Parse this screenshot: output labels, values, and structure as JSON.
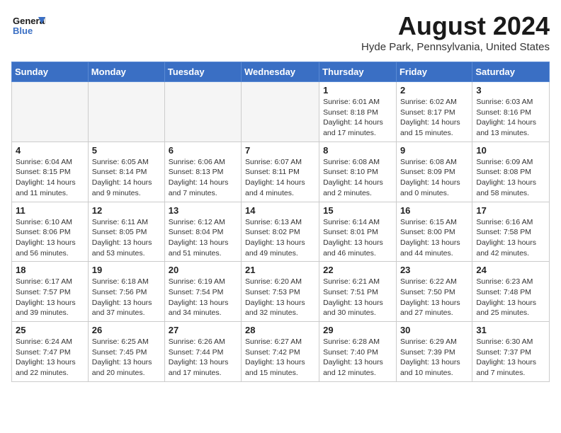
{
  "header": {
    "logo_text_general": "General",
    "logo_text_blue": "Blue",
    "month_year": "August 2024",
    "location": "Hyde Park, Pennsylvania, United States"
  },
  "weekdays": [
    "Sunday",
    "Monday",
    "Tuesday",
    "Wednesday",
    "Thursday",
    "Friday",
    "Saturday"
  ],
  "weeks": [
    [
      {
        "day": "",
        "empty": true
      },
      {
        "day": "",
        "empty": true
      },
      {
        "day": "",
        "empty": true
      },
      {
        "day": "",
        "empty": true
      },
      {
        "day": "1",
        "sunrise": "6:01 AM",
        "sunset": "8:18 PM",
        "daylight": "14 hours and 17 minutes."
      },
      {
        "day": "2",
        "sunrise": "6:02 AM",
        "sunset": "8:17 PM",
        "daylight": "14 hours and 15 minutes."
      },
      {
        "day": "3",
        "sunrise": "6:03 AM",
        "sunset": "8:16 PM",
        "daylight": "14 hours and 13 minutes."
      }
    ],
    [
      {
        "day": "4",
        "sunrise": "6:04 AM",
        "sunset": "8:15 PM",
        "daylight": "14 hours and 11 minutes."
      },
      {
        "day": "5",
        "sunrise": "6:05 AM",
        "sunset": "8:14 PM",
        "daylight": "14 hours and 9 minutes."
      },
      {
        "day": "6",
        "sunrise": "6:06 AM",
        "sunset": "8:13 PM",
        "daylight": "14 hours and 7 minutes."
      },
      {
        "day": "7",
        "sunrise": "6:07 AM",
        "sunset": "8:11 PM",
        "daylight": "14 hours and 4 minutes."
      },
      {
        "day": "8",
        "sunrise": "6:08 AM",
        "sunset": "8:10 PM",
        "daylight": "14 hours and 2 minutes."
      },
      {
        "day": "9",
        "sunrise": "6:08 AM",
        "sunset": "8:09 PM",
        "daylight": "14 hours and 0 minutes."
      },
      {
        "day": "10",
        "sunrise": "6:09 AM",
        "sunset": "8:08 PM",
        "daylight": "13 hours and 58 minutes."
      }
    ],
    [
      {
        "day": "11",
        "sunrise": "6:10 AM",
        "sunset": "8:06 PM",
        "daylight": "13 hours and 56 minutes."
      },
      {
        "day": "12",
        "sunrise": "6:11 AM",
        "sunset": "8:05 PM",
        "daylight": "13 hours and 53 minutes."
      },
      {
        "day": "13",
        "sunrise": "6:12 AM",
        "sunset": "8:04 PM",
        "daylight": "13 hours and 51 minutes."
      },
      {
        "day": "14",
        "sunrise": "6:13 AM",
        "sunset": "8:02 PM",
        "daylight": "13 hours and 49 minutes."
      },
      {
        "day": "15",
        "sunrise": "6:14 AM",
        "sunset": "8:01 PM",
        "daylight": "13 hours and 46 minutes."
      },
      {
        "day": "16",
        "sunrise": "6:15 AM",
        "sunset": "8:00 PM",
        "daylight": "13 hours and 44 minutes."
      },
      {
        "day": "17",
        "sunrise": "6:16 AM",
        "sunset": "7:58 PM",
        "daylight": "13 hours and 42 minutes."
      }
    ],
    [
      {
        "day": "18",
        "sunrise": "6:17 AM",
        "sunset": "7:57 PM",
        "daylight": "13 hours and 39 minutes."
      },
      {
        "day": "19",
        "sunrise": "6:18 AM",
        "sunset": "7:56 PM",
        "daylight": "13 hours and 37 minutes."
      },
      {
        "day": "20",
        "sunrise": "6:19 AM",
        "sunset": "7:54 PM",
        "daylight": "13 hours and 34 minutes."
      },
      {
        "day": "21",
        "sunrise": "6:20 AM",
        "sunset": "7:53 PM",
        "daylight": "13 hours and 32 minutes."
      },
      {
        "day": "22",
        "sunrise": "6:21 AM",
        "sunset": "7:51 PM",
        "daylight": "13 hours and 30 minutes."
      },
      {
        "day": "23",
        "sunrise": "6:22 AM",
        "sunset": "7:50 PM",
        "daylight": "13 hours and 27 minutes."
      },
      {
        "day": "24",
        "sunrise": "6:23 AM",
        "sunset": "7:48 PM",
        "daylight": "13 hours and 25 minutes."
      }
    ],
    [
      {
        "day": "25",
        "sunrise": "6:24 AM",
        "sunset": "7:47 PM",
        "daylight": "13 hours and 22 minutes."
      },
      {
        "day": "26",
        "sunrise": "6:25 AM",
        "sunset": "7:45 PM",
        "daylight": "13 hours and 20 minutes."
      },
      {
        "day": "27",
        "sunrise": "6:26 AM",
        "sunset": "7:44 PM",
        "daylight": "13 hours and 17 minutes."
      },
      {
        "day": "28",
        "sunrise": "6:27 AM",
        "sunset": "7:42 PM",
        "daylight": "13 hours and 15 minutes."
      },
      {
        "day": "29",
        "sunrise": "6:28 AM",
        "sunset": "7:40 PM",
        "daylight": "13 hours and 12 minutes."
      },
      {
        "day": "30",
        "sunrise": "6:29 AM",
        "sunset": "7:39 PM",
        "daylight": "13 hours and 10 minutes."
      },
      {
        "day": "31",
        "sunrise": "6:30 AM",
        "sunset": "7:37 PM",
        "daylight": "13 hours and 7 minutes."
      }
    ]
  ]
}
